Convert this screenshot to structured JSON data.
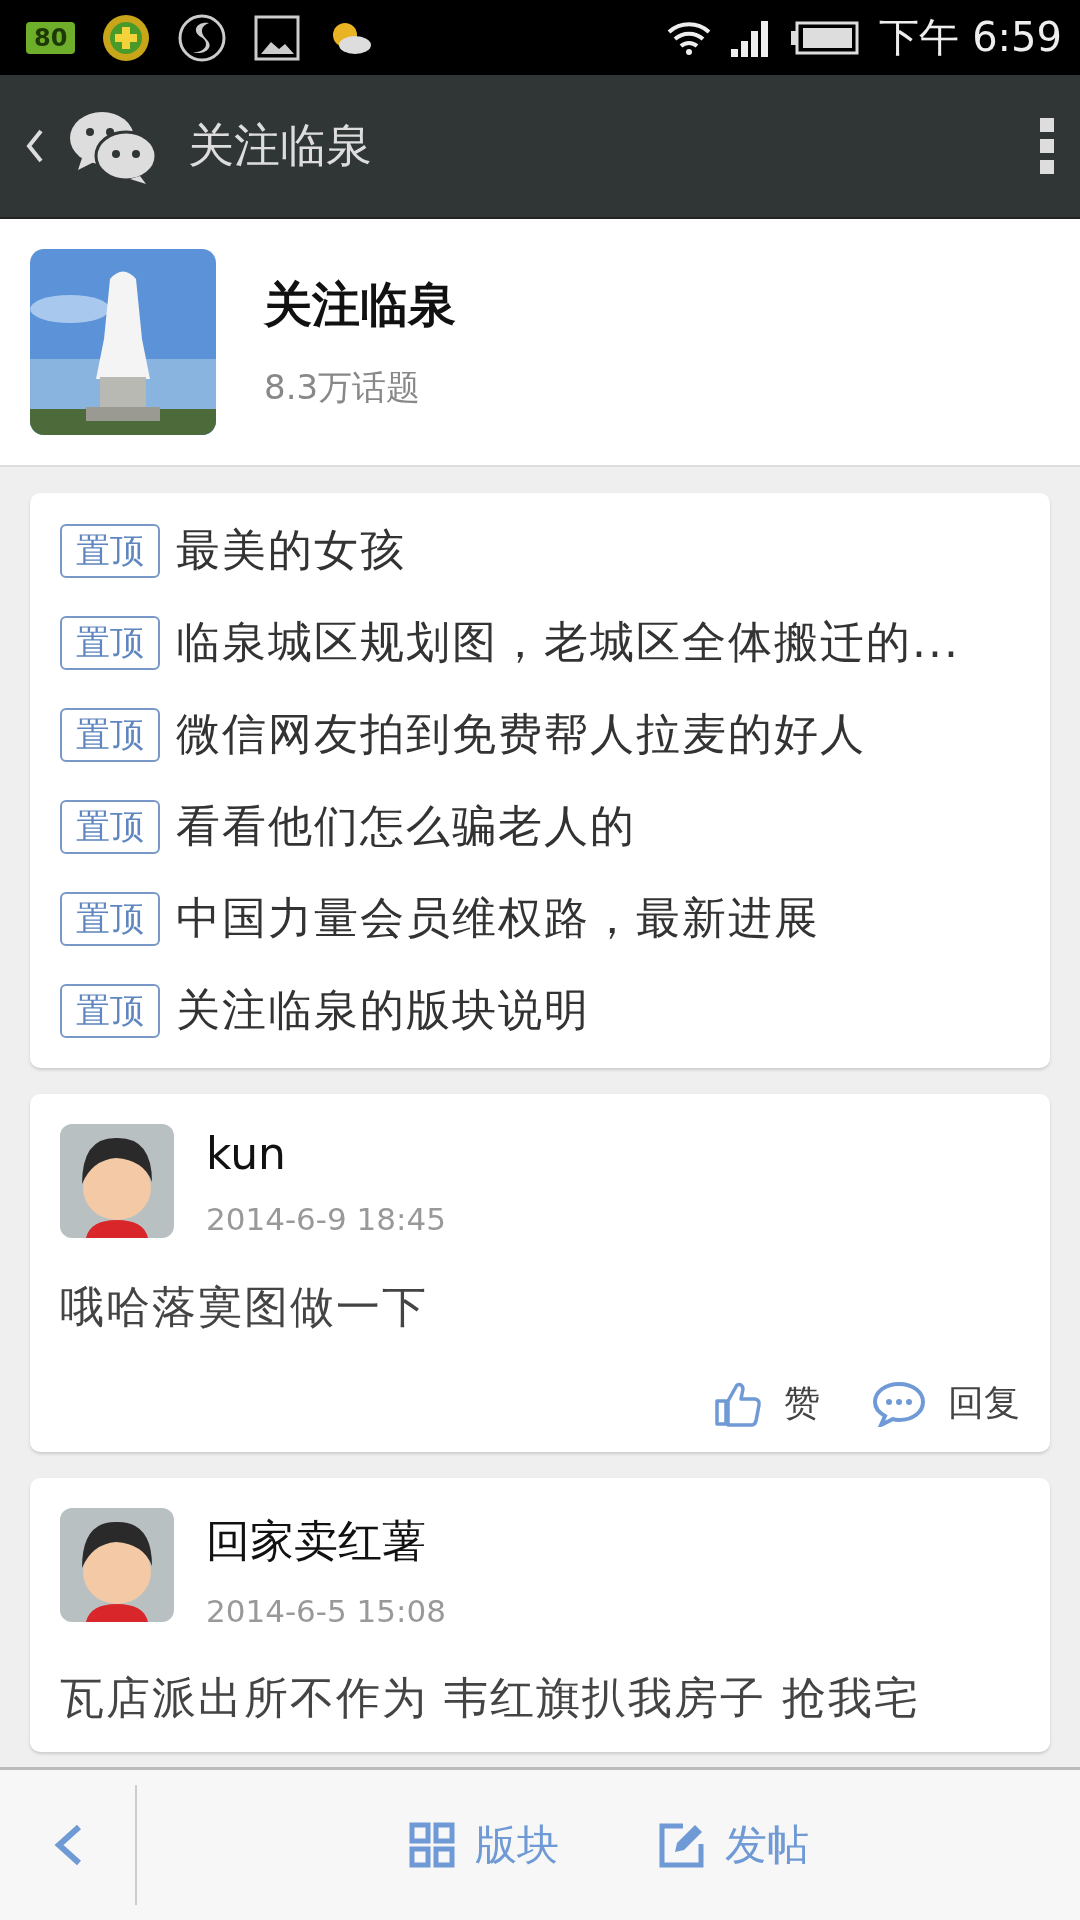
{
  "status_bar": {
    "battery_badge": "80",
    "time": "下午 6:59"
  },
  "header": {
    "title": "关注临泉"
  },
  "forum": {
    "name": "关注临泉",
    "topics": "8.3万话题"
  },
  "pinned": [
    {
      "tag": "置顶",
      "title": "最美的女孩"
    },
    {
      "tag": "置顶",
      "title": "临泉城区规划图，老城区全体搬迁的..."
    },
    {
      "tag": "置顶",
      "title": "微信网友拍到免费帮人拉麦的好人"
    },
    {
      "tag": "置顶",
      "title": "看看他们怎么骗老人的"
    },
    {
      "tag": "置顶",
      "title": "中国力量会员维权路，最新进展"
    },
    {
      "tag": "置顶",
      "title": "关注临泉的版块说明"
    }
  ],
  "posts": [
    {
      "author": "kun",
      "time": "2014-6-9 18:45",
      "body": "哦哈落寞图做一下",
      "actions": [
        {
          "kind": "like",
          "label": "赞"
        },
        {
          "kind": "reply",
          "label": "回复"
        }
      ]
    },
    {
      "author": "回家卖红薯",
      "time": "2014-6-5 15:08",
      "body": "瓦店派出所不作为  韦红旗扒我房子  抢我宅"
    }
  ],
  "bottom_bar": {
    "sections": "版块",
    "post": "发帖"
  }
}
